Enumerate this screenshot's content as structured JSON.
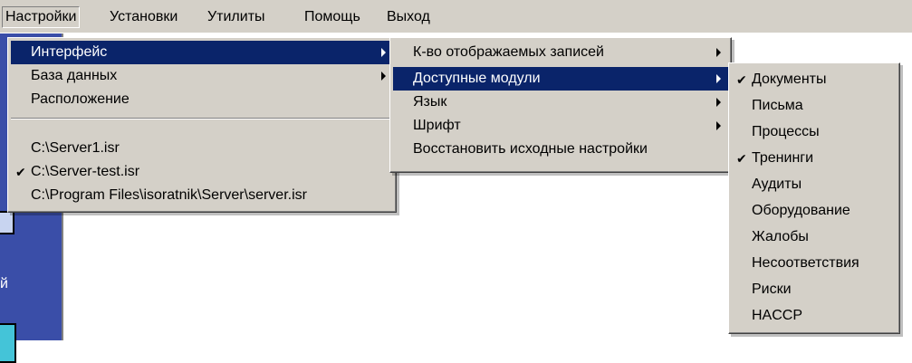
{
  "menubar": {
    "items": [
      {
        "label": "Настройки"
      },
      {
        "label": "Установки"
      },
      {
        "label": "Утилиты"
      },
      {
        "label": "Помощь"
      },
      {
        "label": "Выход"
      }
    ]
  },
  "settings_menu": {
    "items": [
      {
        "label": "Интерфейс"
      },
      {
        "label": "База данных"
      },
      {
        "label": "Расположение"
      }
    ],
    "recent_files": [
      {
        "label": "C:\\Server1.isr",
        "checked": false
      },
      {
        "label": "C:\\Server-test.isr",
        "checked": true
      },
      {
        "label": "C:\\Program Files\\isoratnik\\Server\\server.isr",
        "checked": false
      }
    ]
  },
  "interface_menu": {
    "items": [
      {
        "label": "К-во отображаемых записей"
      },
      {
        "label": "Доступные модули"
      },
      {
        "label": "Язык"
      },
      {
        "label": "Шрифт"
      },
      {
        "label": "Восстановить исходные настройки"
      }
    ]
  },
  "modules_menu": {
    "items": [
      {
        "label": "Документы",
        "checked": true
      },
      {
        "label": "Письма",
        "checked": false
      },
      {
        "label": "Процессы",
        "checked": false
      },
      {
        "label": "Тренинги",
        "checked": true
      },
      {
        "label": "Аудиты",
        "checked": false
      },
      {
        "label": "Оборудование",
        "checked": false
      },
      {
        "label": "Жалобы",
        "checked": false
      },
      {
        "label": "Несоответствия",
        "checked": false
      },
      {
        "label": "Риски",
        "checked": false
      },
      {
        "label": "HACCP",
        "checked": false
      }
    ]
  },
  "background": {
    "left_text": "й"
  },
  "check_glyph": "✔"
}
